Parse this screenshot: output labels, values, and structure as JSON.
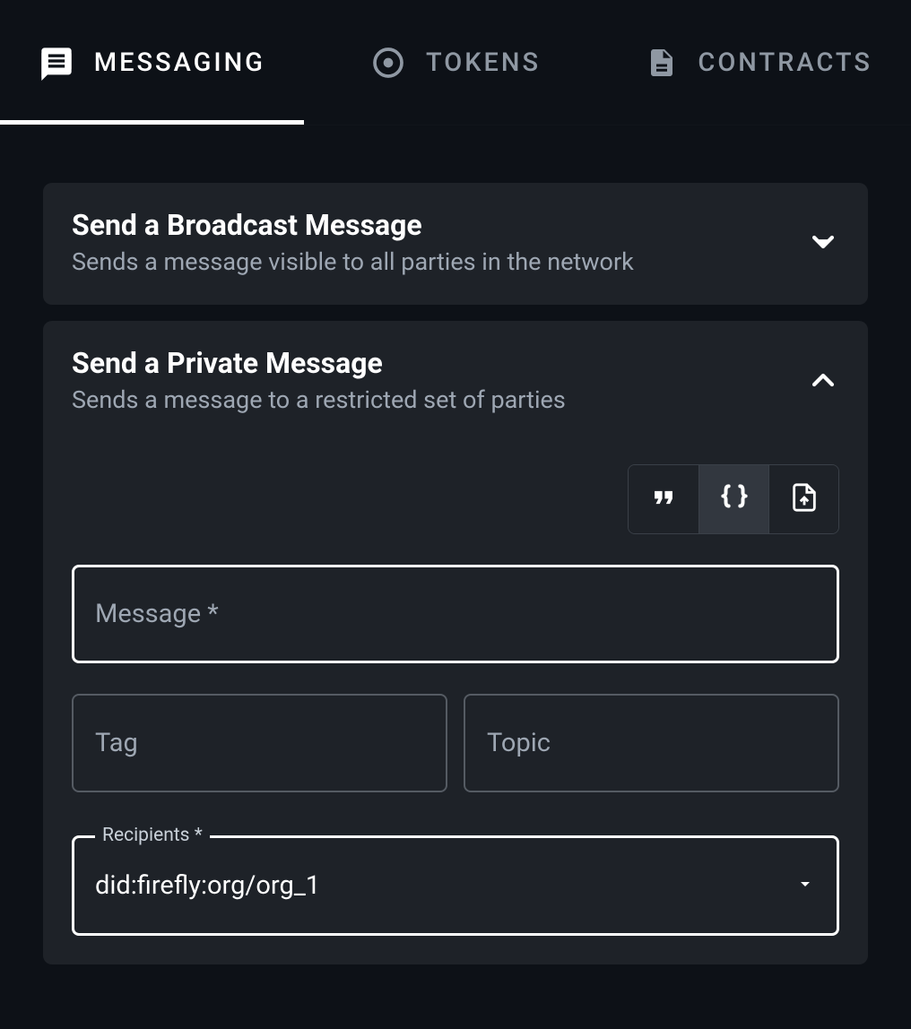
{
  "tabs": [
    {
      "label": "MESSAGING",
      "icon": "message-icon",
      "active": true
    },
    {
      "label": "TOKENS",
      "icon": "token-icon",
      "active": false
    },
    {
      "label": "CONTRACTS",
      "icon": "contract-icon",
      "active": false
    }
  ],
  "cards": {
    "broadcast": {
      "title": "Send a Broadcast Message",
      "subtitle": "Sends a message visible to all parties in the network",
      "expanded": false
    },
    "private": {
      "title": "Send a Private Message",
      "subtitle": "Sends a message to a restricted set of parties",
      "expanded": true,
      "format_options": [
        {
          "name": "quote",
          "selected": false
        },
        {
          "name": "json",
          "selected": true
        },
        {
          "name": "file",
          "selected": false
        }
      ],
      "fields": {
        "message": {
          "label": "Message *",
          "value": ""
        },
        "tag": {
          "label": "Tag",
          "value": ""
        },
        "topic": {
          "label": "Topic",
          "value": ""
        },
        "recipients": {
          "label": "Recipients *",
          "value": "did:firefly:org/org_1"
        }
      }
    }
  }
}
